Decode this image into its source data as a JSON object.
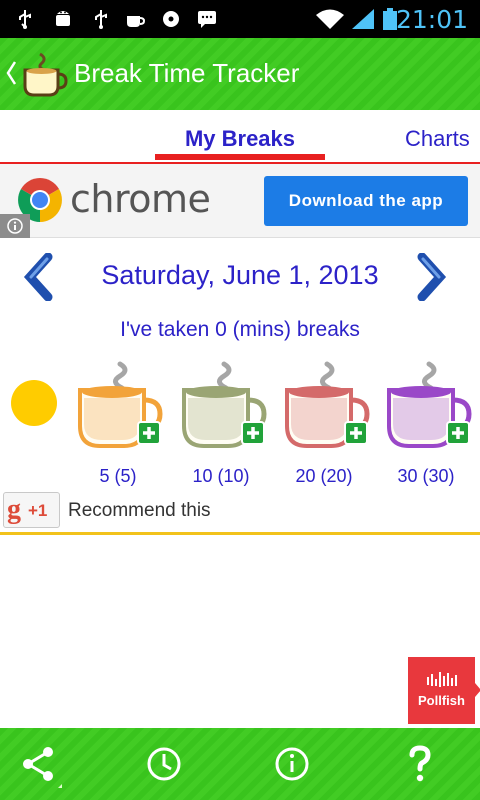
{
  "status_bar": {
    "time": "21:01"
  },
  "action_bar": {
    "title": "Break Time Tracker"
  },
  "tabs": [
    {
      "label": "My Breaks",
      "active": true
    },
    {
      "label": "Charts",
      "active": false
    }
  ],
  "ad": {
    "brand_text": "chrome",
    "cta_label": "Download the app",
    "info_icon": "info-icon"
  },
  "date_nav": {
    "date": "Saturday, June 1, 2013"
  },
  "summary": "I've taken 0 (mins) breaks",
  "cups": [
    {
      "label": "5 (5)",
      "color": "#f2a33a"
    },
    {
      "label": "10 (10)",
      "color": "#9aa574"
    },
    {
      "label": "20 (20)",
      "color": "#d46a6a"
    },
    {
      "label": "30 (30)",
      "color": "#9a48c8"
    }
  ],
  "recommend": {
    "g_letter": "g",
    "plus_one": "+1",
    "label": "Recommend this"
  },
  "pollfish": {
    "label": "Pollfish"
  },
  "colors": {
    "accent_green": "#39c41d",
    "text_blue": "#2c22c8",
    "tab_red": "#e82020",
    "sun_yellow": "#ffcc00"
  }
}
